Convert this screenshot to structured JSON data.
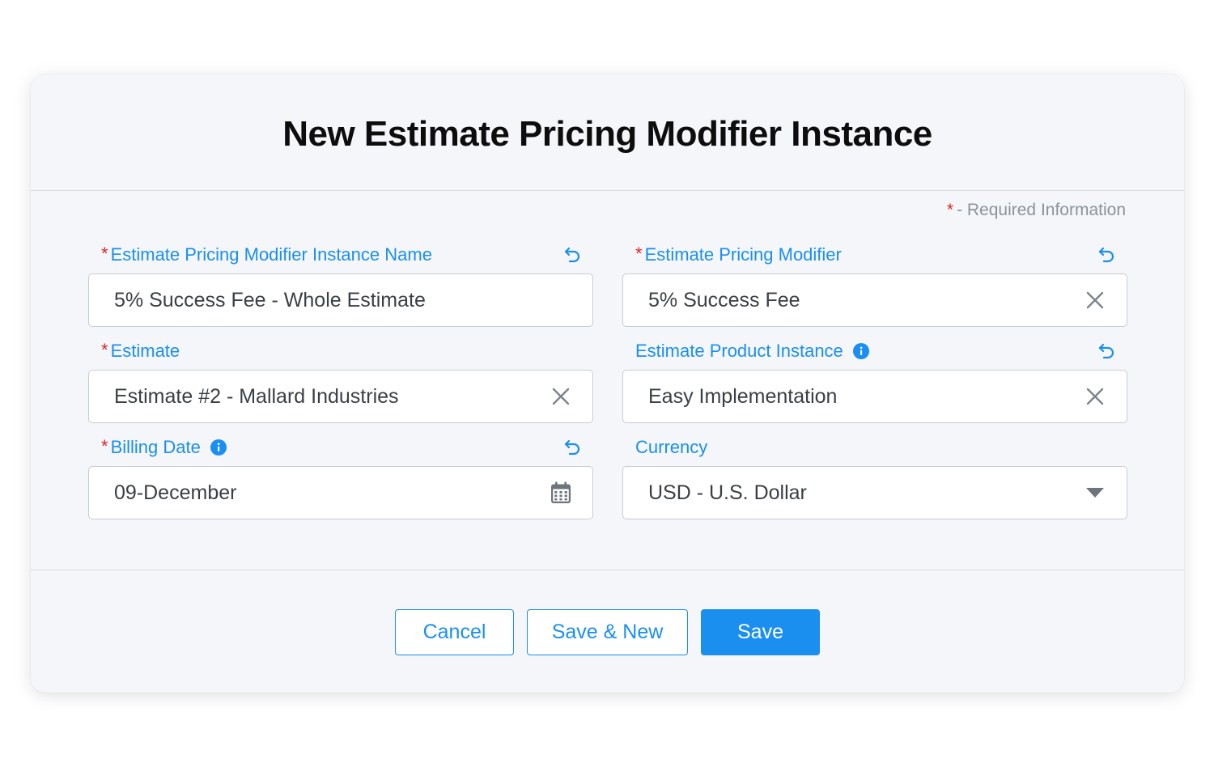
{
  "dialog": {
    "title": "New Estimate Pricing Modifier Instance",
    "required_note": {
      "star": "*",
      "text": "- Required Information"
    }
  },
  "fields": {
    "instance_name": {
      "required_mark": "*",
      "label": "Estimate Pricing Modifier Instance Name",
      "value": "5% Success Fee - Whole Estimate"
    },
    "pricing_modifier": {
      "required_mark": "*",
      "label": "Estimate Pricing Modifier",
      "value": "5% Success Fee"
    },
    "estimate": {
      "required_mark": "*",
      "label": "Estimate",
      "value": "Estimate #2 - Mallard Industries"
    },
    "product_instance": {
      "label": "Estimate Product Instance",
      "value": "Easy Implementation"
    },
    "billing_date": {
      "required_mark": "*",
      "label": "Billing Date",
      "value": "09-December"
    },
    "currency": {
      "label": "Currency",
      "value": "USD - U.S. Dollar"
    }
  },
  "buttons": {
    "cancel": "Cancel",
    "save_new": "Save & New",
    "save": "Save"
  },
  "icons": {
    "undo": "undo-icon",
    "clear": "close-icon",
    "info": "info-icon",
    "calendar": "calendar-icon",
    "dropdown": "caret-down-icon"
  },
  "colors": {
    "accent": "#1a8ff0",
    "required": "#e02424",
    "dialog_bg": "#f4f6f9"
  }
}
